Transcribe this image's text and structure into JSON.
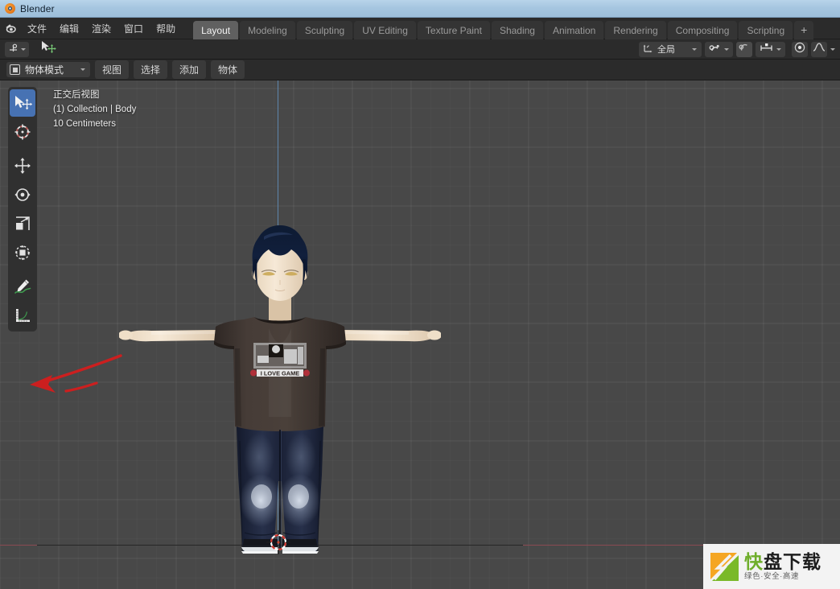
{
  "window": {
    "title": "Blender",
    "logo_icon": "blender-logo-icon"
  },
  "topbar": {
    "app_icon": "blender-icon",
    "menus": [
      {
        "label": "文件",
        "name": "menu-file"
      },
      {
        "label": "编辑",
        "name": "menu-edit"
      },
      {
        "label": "渲染",
        "name": "menu-render"
      },
      {
        "label": "窗口",
        "name": "menu-window"
      },
      {
        "label": "帮助",
        "name": "menu-help"
      }
    ],
    "tabs": [
      {
        "label": "Layout",
        "active": true
      },
      {
        "label": "Modeling",
        "active": false
      },
      {
        "label": "Sculpting",
        "active": false
      },
      {
        "label": "UV Editing",
        "active": false
      },
      {
        "label": "Texture Paint",
        "active": false
      },
      {
        "label": "Shading",
        "active": false
      },
      {
        "label": "Animation",
        "active": false
      },
      {
        "label": "Rendering",
        "active": false
      },
      {
        "label": "Compositing",
        "active": false
      },
      {
        "label": "Scripting",
        "active": false
      }
    ],
    "add_tab_label": "+"
  },
  "toolrow": {
    "editor_type_icon": "editor-type-icon",
    "gizmo_icon": "cursor-move-gizmo-icon",
    "transform_orientation": {
      "icon": "orientation-axes-icon",
      "value": "全局"
    },
    "snap_icon": "snap-magnet-icon",
    "snap_target_icon": "snap-target-icon",
    "snap_increment_icon": "snap-increment-icon",
    "proportional_edit_icon": "proportional-editing-icon",
    "falloff_icon": "proportional-falloff-icon"
  },
  "viewport_header": {
    "mode": {
      "icon": "object-mode-icon",
      "value": "物体模式"
    },
    "menus": [
      {
        "label": "视图",
        "name": "vp-menu-view"
      },
      {
        "label": "选择",
        "name": "vp-menu-select"
      },
      {
        "label": "添加",
        "name": "vp-menu-add"
      },
      {
        "label": "物体",
        "name": "vp-menu-object"
      }
    ]
  },
  "viewport": {
    "overlay": {
      "view_name": "正交后视图",
      "collection": "(1) Collection | Body",
      "grid_scale": "10 Centimeters"
    },
    "colors": {
      "background": "#484848",
      "axis_z": "#5e86ad",
      "axis_x": "#8a4a52",
      "active_tool": "#4772b3",
      "annotation_arrow": "#cc1f1f"
    },
    "toolbar": [
      {
        "name": "tool-tweak-select",
        "icon": "cursor-select-move-icon",
        "active": true
      },
      {
        "name": "tool-cursor",
        "icon": "3d-cursor-icon",
        "active": false
      },
      {
        "name": "tool-move",
        "icon": "move-arrows-icon",
        "active": false
      },
      {
        "name": "tool-rotate",
        "icon": "rotate-icon",
        "active": false
      },
      {
        "name": "tool-scale",
        "icon": "scale-icon",
        "active": false
      },
      {
        "name": "tool-transform",
        "icon": "transform-icon",
        "active": false
      },
      {
        "name": "tool-annotate",
        "icon": "annotate-pencil-icon",
        "active": false
      },
      {
        "name": "tool-measure",
        "icon": "measure-ruler-icon",
        "active": false
      }
    ],
    "object": {
      "name": "Body",
      "shirt_print_text": "I LOVE GAME"
    },
    "cursor_3d_icon": "3d-cursor-crosshair-icon"
  },
  "watermark": {
    "logo_icon": "kuaipan-logo-icon",
    "title_first": "快",
    "title_rest": "盘下载",
    "subtitle": "绿色·安全·高速"
  }
}
